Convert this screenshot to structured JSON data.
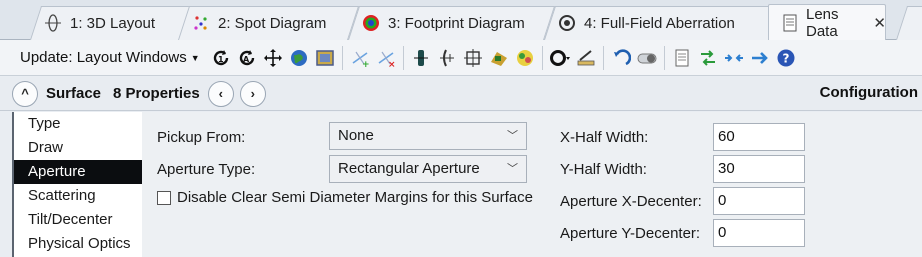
{
  "tabs": [
    {
      "label": "1: 3D Layout",
      "icon": "3d-layout-icon",
      "active": false
    },
    {
      "label": "2: Spot Diagram",
      "icon": "spot-diagram-icon",
      "active": false
    },
    {
      "label": "3: Footprint Diagram",
      "icon": "footprint-diagram-icon",
      "active": false
    },
    {
      "label": "4: Full-Field Aberration",
      "icon": "full-field-aberration-icon",
      "active": false
    },
    {
      "label": "Lens Data",
      "icon": "lens-data-icon",
      "active": true,
      "close": "✕"
    }
  ],
  "toolbar": {
    "update_label": "Update: Layout Windows",
    "icons": [
      "refresh-icon",
      "auto-update-icon",
      "move-icon",
      "globe-icon",
      "image-icon",
      "insert-surface-icon",
      "delete-surface-icon",
      "lens-icon",
      "mirror-icon",
      "grid-icon",
      "palette-icon",
      "color-wheel-icon",
      "ring-icon",
      "ruler-edit-icon",
      "undo-icon",
      "toggle-icon",
      "document-icon",
      "swap-icon",
      "compress-icon",
      "arrow-right-icon",
      "help-icon"
    ]
  },
  "nav": {
    "collapse_symbol": "^",
    "title": "Surface",
    "properties": "8 Properties",
    "prev_symbol": "‹",
    "next_symbol": "›",
    "configuration": "Configuration"
  },
  "categories": [
    {
      "label": "Type",
      "selected": false
    },
    {
      "label": "Draw",
      "selected": false
    },
    {
      "label": "Aperture",
      "selected": true
    },
    {
      "label": "Scattering",
      "selected": false
    },
    {
      "label": "Tilt/Decenter",
      "selected": false
    },
    {
      "label": "Physical Optics",
      "selected": false
    }
  ],
  "aperture": {
    "pickup_label": "Pickup From:",
    "pickup_value": "None",
    "type_label": "Aperture Type:",
    "type_value": "Rectangular Aperture",
    "disable_margins_label": "Disable Clear Semi Diameter Margins for this Surface",
    "disable_margins_checked": false,
    "x_half_width_label": "X-Half Width:",
    "x_half_width_value": "60",
    "y_half_width_label": "Y-Half Width:",
    "y_half_width_value": "30",
    "x_decenter_label": "Aperture X-Decenter:",
    "x_decenter_value": "0",
    "y_decenter_label": "Aperture Y-Decenter:",
    "y_decenter_value": "0"
  }
}
